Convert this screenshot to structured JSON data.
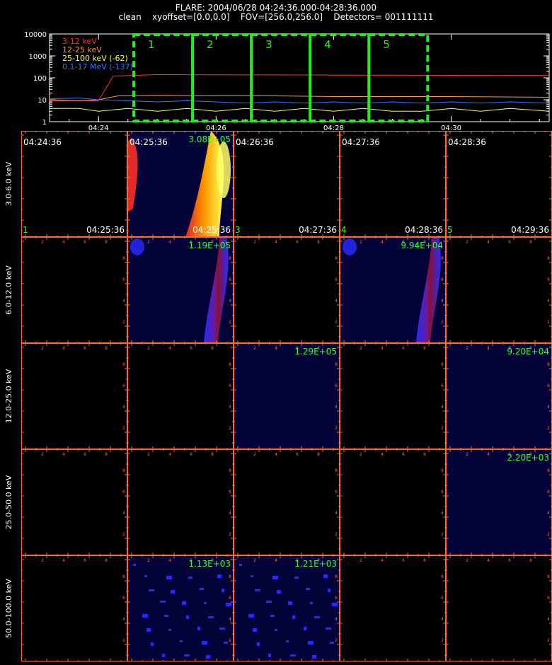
{
  "header": {
    "line1": "FLARE: 2004/06/28 04:24:36.000-04:28:36.000",
    "line2": "clean    xyoffset=[0.0,0.0]    FOV=[256.0,256.0]    Detectors= 001111111"
  },
  "chart_data": [
    {
      "type": "line",
      "name": "lightcurve",
      "yscale": "log",
      "ylim": [
        1,
        10000
      ],
      "xlim": [
        "04:23:10",
        "04:31:40"
      ],
      "y_ticks": [
        "10000",
        "1000",
        "100",
        "10",
        "1"
      ],
      "x_ticks": [
        "04:24",
        "04:26",
        "04:28",
        "04:30"
      ],
      "series": [
        {
          "name": "3-12 keV",
          "color": "#ff3333",
          "x": [
            "04:23:10",
            "04:23:40",
            "04:24:00",
            "04:24:15",
            "04:25:00",
            "04:26:00",
            "04:27:00",
            "04:28:00",
            "04:29:00",
            "04:30:00",
            "04:31:40"
          ],
          "values": [
            9,
            9,
            9,
            120,
            140,
            138,
            136,
            134,
            132,
            130,
            128
          ]
        },
        {
          "name": "12-25 keV",
          "color": "#ff9933",
          "x": [
            "04:23:10",
            "04:23:40",
            "04:24:00",
            "04:24:20",
            "04:25:00",
            "04:26:00",
            "04:27:00",
            "04:28:00",
            "04:29:00",
            "04:30:00",
            "04:31:40"
          ],
          "values": [
            10,
            9,
            10,
            15,
            16,
            15,
            15,
            14,
            14,
            14,
            13
          ]
        },
        {
          "name": "25-100 keV (-62)",
          "color": "#ffff33",
          "x": [
            "04:23:10",
            "04:23:40",
            "04:24:00",
            "04:24:30",
            "04:25:00",
            "04:25:30",
            "04:26:00",
            "04:26:30",
            "04:27:00",
            "04:27:30",
            "04:28:00",
            "04:28:30",
            "04:29:00",
            "04:29:30",
            "04:30:00",
            "04:30:30",
            "04:31:00",
            "04:31:40"
          ],
          "values": [
            4,
            4,
            3,
            4,
            3,
            4,
            3,
            4,
            3,
            4,
            3,
            4,
            3,
            3,
            4,
            3,
            4,
            3
          ]
        },
        {
          "name": "0.1-17 MeV (-137)",
          "color": "#3377ff",
          "x": [
            "04:23:10",
            "04:23:40",
            "04:24:00",
            "04:24:30",
            "04:25:00",
            "04:25:30",
            "04:26:00",
            "04:26:30",
            "04:27:00",
            "04:27:30",
            "04:28:00",
            "04:28:30",
            "04:29:00",
            "04:29:30",
            "04:30:00",
            "04:30:30",
            "04:31:00",
            "04:31:40"
          ],
          "values": [
            11,
            12,
            10,
            9,
            8,
            9,
            8,
            7,
            8,
            7,
            8,
            7,
            8,
            7,
            8,
            7,
            8,
            7
          ]
        }
      ],
      "intervals": [
        {
          "label": "1",
          "start": "04:24:36",
          "end": "04:25:36"
        },
        {
          "label": "2",
          "start": "04:25:36",
          "end": "04:26:36"
        },
        {
          "label": "3",
          "start": "04:26:36",
          "end": "04:27:36"
        },
        {
          "label": "4",
          "start": "04:27:36",
          "end": "04:28:36"
        },
        {
          "label": "5",
          "start": "04:28:36",
          "end": "04:29:36"
        }
      ],
      "interval_color": "#22ee22"
    },
    {
      "type": "heatmap",
      "name": "image-grid",
      "energy_bands": [
        "3.0-6.0 keV",
        "6.0-12.0 keV",
        "12.0-25.0 keV",
        "25.0-50.0 keV",
        "50.0-100.0 keV"
      ],
      "time_labels": [
        "04:24:36",
        "04:25:36",
        "04:26:36",
        "04:27:36",
        "04:28:36"
      ],
      "end_labels": [
        "04:25:36",
        "04:25:36",
        "04:27:36",
        "04:28:36",
        "04:29:36"
      ],
      "interval_numbers": [
        "1",
        "",
        "3",
        "4",
        "5"
      ],
      "axis_ticks": [
        "2",
        "4",
        "6",
        "8"
      ],
      "axis_color": "#ff6a2a",
      "max_label_color": "#33ff33",
      "cells": [
        [
          {
            "max": ""
          },
          {
            "max": "3.08E+05",
            "map": "fire"
          },
          {
            "max": ""
          },
          {
            "max": ""
          },
          {
            "max": ""
          }
        ],
        [
          {
            "max": ""
          },
          {
            "max": "1.19E+05",
            "map": "ribbon"
          },
          {
            "max": ""
          },
          {
            "max": "9.94E+04",
            "map": "ribbon"
          },
          {
            "max": ""
          }
        ],
        [
          {
            "max": ""
          },
          {
            "max": ""
          },
          {
            "max": "1.29E+05",
            "map": "flat"
          },
          {
            "max": ""
          },
          {
            "max": "9.20E+04",
            "map": "flat"
          }
        ],
        [
          {
            "max": ""
          },
          {
            "max": ""
          },
          {
            "max": ""
          },
          {
            "max": ""
          },
          {
            "max": "2.20E+03",
            "map": "flat"
          }
        ],
        [
          {
            "max": ""
          },
          {
            "max": "1.13E+03",
            "map": "noise"
          },
          {
            "max": "1.21E+03",
            "map": "noise"
          },
          {
            "max": ""
          },
          {
            "max": ""
          }
        ]
      ]
    }
  ]
}
